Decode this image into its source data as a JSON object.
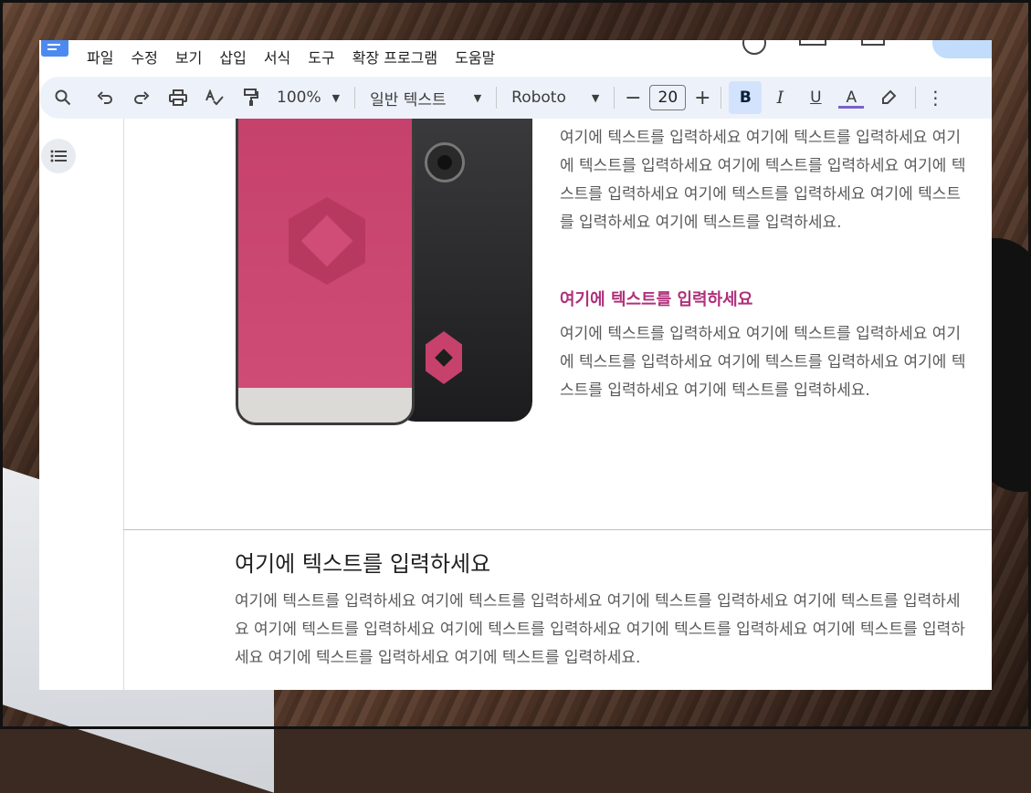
{
  "menu": {
    "items": [
      "파일",
      "수정",
      "보기",
      "삽입",
      "서식",
      "도구",
      "확장 프로그램",
      "도움말"
    ]
  },
  "toolbar": {
    "zoom": "100%",
    "style": "일반 텍스트",
    "font": "Roboto",
    "font_size": "20",
    "bold_label": "B",
    "italic_label": "I",
    "underline_label": "U",
    "text_color_label": "A",
    "icons": [
      "search-icon",
      "undo-icon",
      "redo-icon",
      "print-icon",
      "spellcheck-icon",
      "paint-format-icon",
      "minus-icon",
      "plus-icon",
      "highlighter-icon",
      "more-icon"
    ]
  },
  "accent": {
    "bold_bg": "#d3e3fd",
    "heading_pink": "#b0307a",
    "phone_pink": "#c6426d"
  },
  "content": {
    "para1": "여기에 텍스트를 입력하세요 여기에 텍스트를 입력하세요 여기에 텍스트를 입력하세요 여기에 텍스트를 입력하세요 여기에 텍스트를 입력하세요 여기에 텍스트를 입력하세요 여기에 텍스트를 입력하세요 여기에 텍스트를 입력하세요.",
    "pink_heading": "여기에 텍스트를 입력하세요",
    "para2": "여기에 텍스트를 입력하세요 여기에 텍스트를 입력하세요 여기에 텍스트를 입력하세요 여기에 텍스트를 입력하세요 여기에 텍스트를 입력하세요 여기에 텍스트를 입력하세요.",
    "heading2": "여기에 텍스트를 입력하세요",
    "para3": "여기에 텍스트를 입력하세요 여기에 텍스트를 입력하세요 여기에 텍스트를 입력하세요 여기에 텍스트를 입력하세요 여기에 텍스트를 입력하세요 여기에 텍스트를 입력하세요 여기에 텍스트를 입력하세요 여기에 텍스트를 입력하세요 여기에 텍스트를 입력하세요 여기에 텍스트를 입력하세요."
  }
}
